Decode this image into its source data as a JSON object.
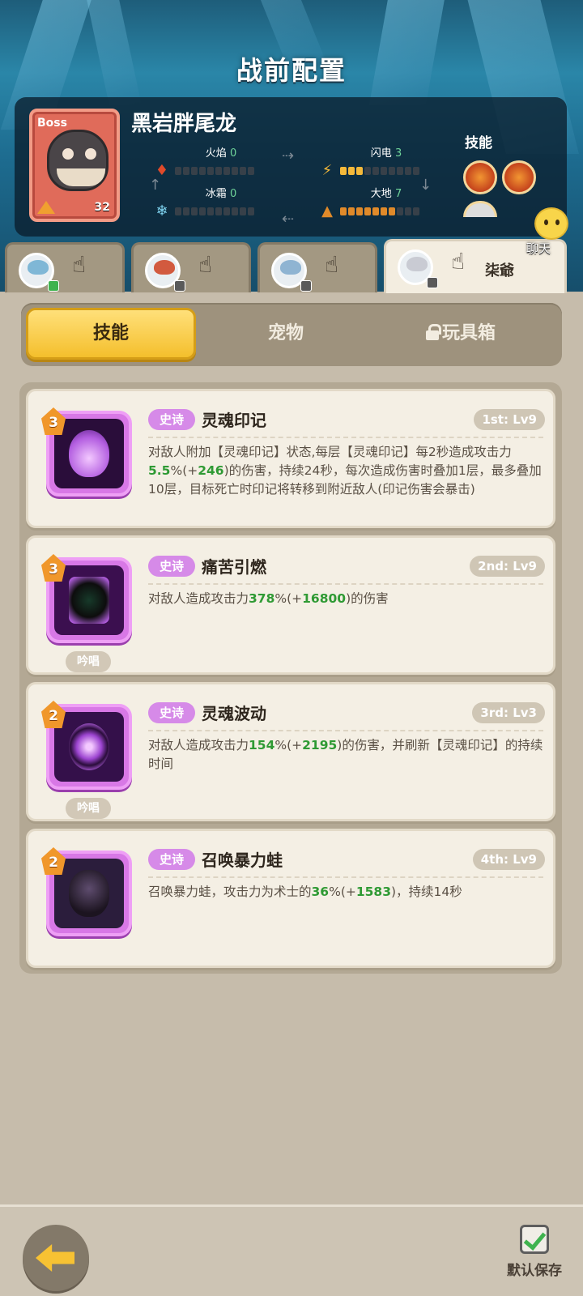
{
  "screen_title": "战前配置",
  "boss": {
    "badge": "Boss",
    "name": "黑岩胖尾龙",
    "level": "32",
    "stats": [
      {
        "label": "火焰",
        "value": "0",
        "filled": 0,
        "color": "#e04a2a",
        "icon": "fire-icon"
      },
      {
        "label": "闪电",
        "value": "3",
        "filled": 3,
        "color": "#f5b93a",
        "icon": "lightning-icon"
      },
      {
        "label": "冰霜",
        "value": "0",
        "filled": 0,
        "color": "#7fd3f0",
        "icon": "snowflake-icon"
      },
      {
        "label": "大地",
        "value": "7",
        "filled": 7,
        "color": "#e08a2a",
        "icon": "earth-icon"
      }
    ],
    "skills_label": "技能"
  },
  "chat_label": "聊天",
  "heroes": [
    {
      "name": "",
      "badge": "chat",
      "active": false
    },
    {
      "name": "",
      "badge": "lock",
      "active": false
    },
    {
      "name": "",
      "badge": "lock",
      "active": false
    },
    {
      "name": "柒爺",
      "badge": "lock",
      "active": true
    }
  ],
  "tabs": [
    {
      "label": "技能",
      "active": true,
      "locked": false
    },
    {
      "label": "宠物",
      "active": false,
      "locked": false
    },
    {
      "label": "玩具箱",
      "active": false,
      "locked": true
    }
  ],
  "skills": [
    {
      "tier": "3",
      "rarity": "史诗",
      "name": "灵魂印记",
      "slot": "1st: Lv9",
      "chant": "",
      "desc_parts": [
        "对敌人附加【灵魂印记】状态,每层【灵魂印记】每2秒造成攻击力",
        "5.5",
        "%(+",
        "246",
        ")的伤害，持续24秒，每次造成伤害时叠加1层，最多叠加10层，目标死亡时印记将转移到附近敌人(印记伤害会暴击)"
      ]
    },
    {
      "tier": "3",
      "rarity": "史诗",
      "name": "痛苦引燃",
      "slot": "2nd: Lv9",
      "chant": "吟唱",
      "desc_parts": [
        "对敌人造成攻击力",
        "378",
        "%(+",
        "16800",
        ")的伤害",
        "",
        ""
      ]
    },
    {
      "tier": "2",
      "rarity": "史诗",
      "name": "灵魂波动",
      "slot": "3rd: Lv3",
      "chant": "吟唱",
      "desc_parts": [
        "对敌人造成攻击力",
        "154",
        "%(+",
        "2195",
        ")的伤害，并刷新【灵魂印记】的持续时间"
      ]
    },
    {
      "tier": "2",
      "rarity": "史诗",
      "name": "召唤暴力蛙",
      "slot": "4th: Lv9",
      "chant": "",
      "desc_parts": [
        "召唤暴力蛙，攻击力为术士的",
        "36",
        "%(+",
        "1583",
        ")，持续14秒"
      ]
    }
  ],
  "bottom": {
    "save_label": "默认保存",
    "save_checked": true
  }
}
